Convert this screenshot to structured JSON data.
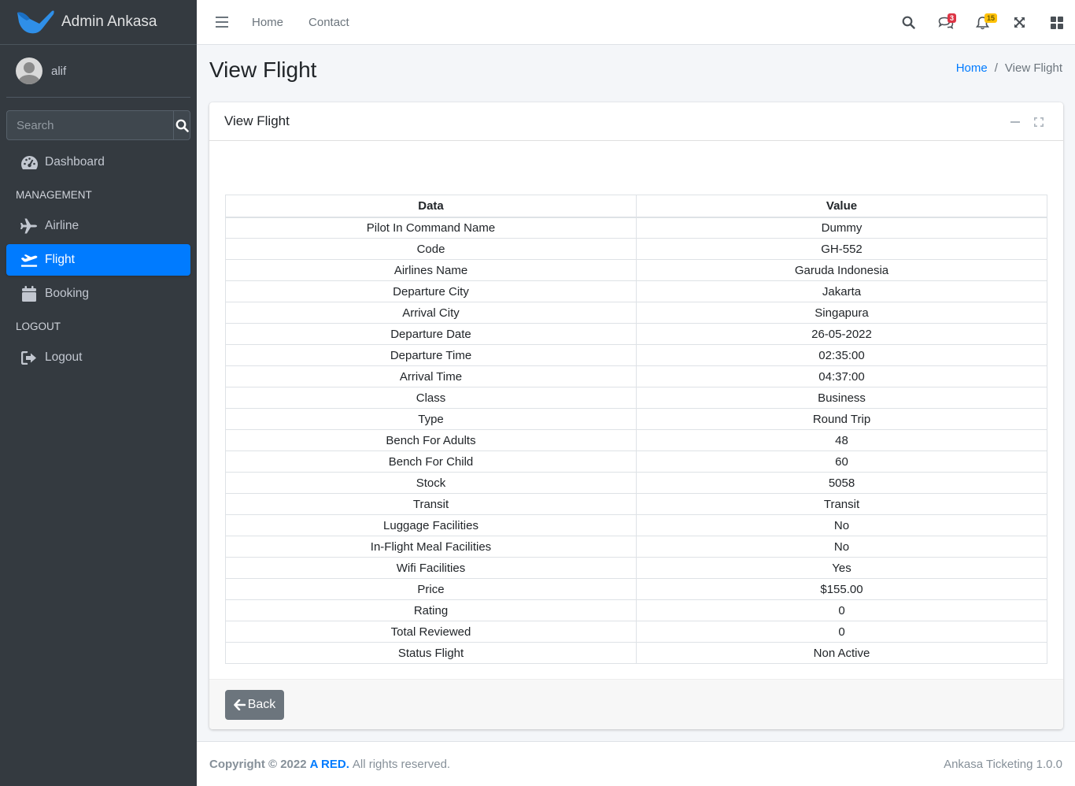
{
  "brand": {
    "name": "Admin Ankasa"
  },
  "user": {
    "name": "alif"
  },
  "sidebar": {
    "search_placeholder": "Search",
    "items": [
      {
        "label": "Dashboard",
        "icon": "tachometer-icon"
      },
      {
        "header": "MANAGEMENT"
      },
      {
        "label": "Airline",
        "icon": "plane-icon"
      },
      {
        "label": "Flight",
        "icon": "plane-departure-icon",
        "active": true
      },
      {
        "label": "Booking",
        "icon": "calendar-icon"
      },
      {
        "header": "LOGOUT"
      },
      {
        "label": "Logout",
        "icon": "sign-out-icon"
      }
    ]
  },
  "topbar": {
    "links": [
      "Home",
      "Contact"
    ],
    "messages_badge": "3",
    "notifications_badge": "15"
  },
  "page": {
    "title": "View Flight",
    "breadcrumb": [
      "Home",
      "View Flight"
    ]
  },
  "card": {
    "title": "View Flight",
    "table": {
      "headers": [
        "Data",
        "Value"
      ],
      "rows": [
        [
          "Pilot In Command Name",
          "Dummy"
        ],
        [
          "Code",
          "GH-552"
        ],
        [
          "Airlines Name",
          "Garuda Indonesia"
        ],
        [
          "Departure City",
          "Jakarta"
        ],
        [
          "Arrival City",
          "Singapura"
        ],
        [
          "Departure Date",
          "26-05-2022"
        ],
        [
          "Departure Time",
          "02:35:00"
        ],
        [
          "Arrival Time",
          "04:37:00"
        ],
        [
          "Class",
          "Business"
        ],
        [
          "Type",
          "Round Trip"
        ],
        [
          "Bench For Adults",
          "48"
        ],
        [
          "Bench For Child",
          "60"
        ],
        [
          "Stock",
          "5058"
        ],
        [
          "Transit",
          "Transit"
        ],
        [
          "Luggage Facilities",
          "No"
        ],
        [
          "In-Flight Meal Facilities",
          "No"
        ],
        [
          "Wifi Facilities",
          "Yes"
        ],
        [
          "Price",
          "$155.00"
        ],
        [
          "Rating",
          "0"
        ],
        [
          "Total Reviewed",
          "0"
        ],
        [
          "Status Flight",
          "Non Active"
        ]
      ]
    },
    "back_label": "Back"
  },
  "footer": {
    "copyright": "Copyright © 2022",
    "brand": "A RED.",
    "rights": "All rights reserved.",
    "version": "Ankasa Ticketing 1.0.0"
  },
  "colors": {
    "sidebar_bg": "#343a40",
    "active": "#007bff",
    "back_button": "#6c757d"
  }
}
